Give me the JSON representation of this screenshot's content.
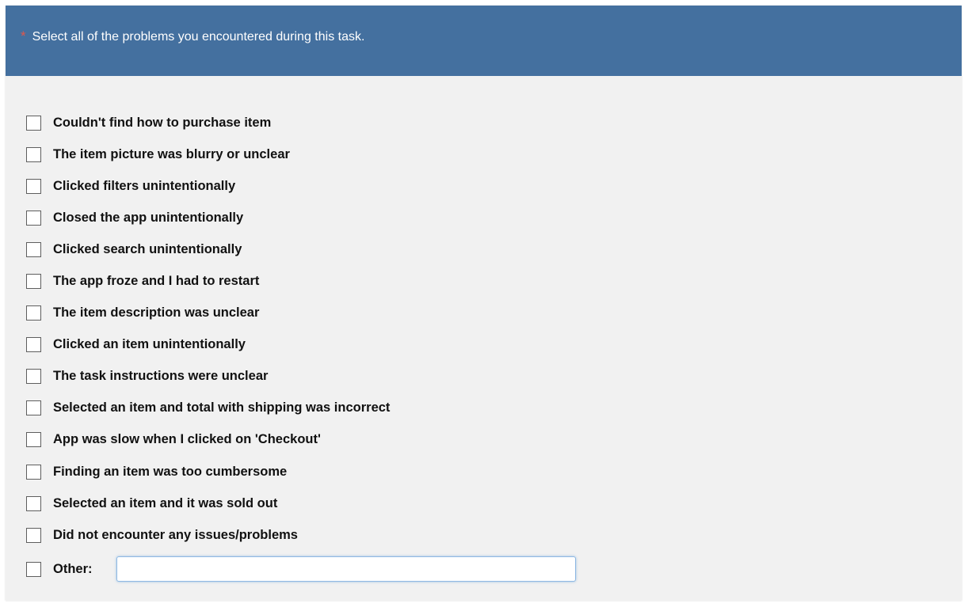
{
  "question": {
    "required_marker": "*",
    "text": "Select all of the problems you encountered during this task."
  },
  "options": [
    {
      "label": "Couldn't find how to purchase item",
      "checked": false
    },
    {
      "label": "The item picture was blurry or unclear",
      "checked": false
    },
    {
      "label": "Clicked filters unintentionally",
      "checked": false
    },
    {
      "label": "Closed the app unintentionally",
      "checked": false
    },
    {
      "label": "Clicked search unintentionally",
      "checked": false
    },
    {
      "label": "The app froze and I had to restart",
      "checked": false
    },
    {
      "label": "The item description was unclear",
      "checked": false
    },
    {
      "label": "Clicked an item unintentionally",
      "checked": false
    },
    {
      "label": "The task instructions were unclear",
      "checked": false
    },
    {
      "label": "Selected an item and total with shipping was incorrect",
      "checked": false
    },
    {
      "label": "App was slow when I clicked on 'Checkout'",
      "checked": false
    },
    {
      "label": "Finding an item was too cumbersome",
      "checked": false
    },
    {
      "label": "Selected an item and it was sold out",
      "checked": false
    },
    {
      "label": "Did not encounter any issues/problems",
      "checked": false
    }
  ],
  "other": {
    "label": "Other:",
    "checked": false,
    "value": ""
  },
  "colors": {
    "header_background": "#44709f",
    "required_marker": "#e0574b",
    "card_background": "#f1f1f1",
    "input_focus_border": "#8fb9e4"
  }
}
